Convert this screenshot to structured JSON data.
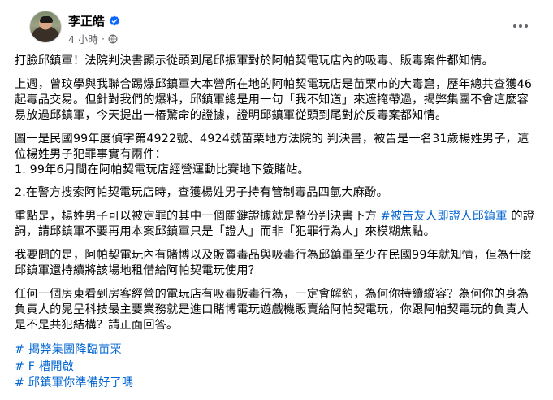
{
  "author": {
    "name": "李正皓",
    "time": "4 小時",
    "separator": "·"
  },
  "post": {
    "p1": "打臉邱鎮軍！法院判決書顯示從頭到尾邱振軍對於阿帕契電玩店內的吸毒、販毒案件都知情。",
    "p2": "上週，曾玟學與我聯合踢爆邱鎮軍大本營所在地的阿帕契電玩店是苗栗市的大毒窟，歷年總共查獲46起毒品交易。但針對我們的爆料，邱鎮軍總是用一句「我不知道」來遮掩帶過，揭弊集團不會這麼容易放過邱鎮軍，今天提出一樁驚命的證據，證明邱鎮軍從頭到尾對於反毒案都知情。",
    "p3": "圖一是民國99年度偵字第4922號、4924號苗栗地方法院的 判決書，被告是一名31歲楊姓男子，這位楊姓男子犯罪事實有兩件：",
    "p3b": "1. 99年6月間在阿帕契電玩店經營運動比賽地下簽賭站。",
    "p4": "2.在警方搜索阿帕契電玩店時，查獲楊姓男子持有管制毒品四氫大麻酚。",
    "p5_before": "重點是，楊姓男子可以被定罪的其中一個關鍵證據就是整份判決書下方 ",
    "p5_tag": "#被告友人即證人邱鎮軍",
    "p5_after": " 的證詞，請邱鎮軍不要再用本案邱鎮軍只是「證人」而非「犯罪行為人」來模糊焦點。",
    "p6": "我要問的是，阿帕契電玩內有賭博以及販賣毒品與吸毒行為邱鎮軍至少在民國99年就知情，但為什麼邱鎮軍還持續將該場地租借給阿帕契電玩使用？",
    "p7": "任何一個房東看到房客經營的電玩店有吸毒販毒行為，一定會解約，為何你持續縱容？為何你的身為負責人的晁呈科技最主要業務就是進口賭博電玩遊戲機販賣給阿帕契電玩，你跟阿帕契電玩的負責人是不是共犯結構？請正面回答。"
  },
  "hashtags": [
    "# 揭弊集團降臨苗栗",
    "# F 槽開啟",
    "# 邱鎮軍你準備好了嗎"
  ],
  "colors": {
    "link": "#0064d1",
    "meta": "#65676b",
    "verified": "#0866ff"
  },
  "icons": [
    "verified-badge-icon",
    "globe-icon",
    "more-options-icon"
  ]
}
